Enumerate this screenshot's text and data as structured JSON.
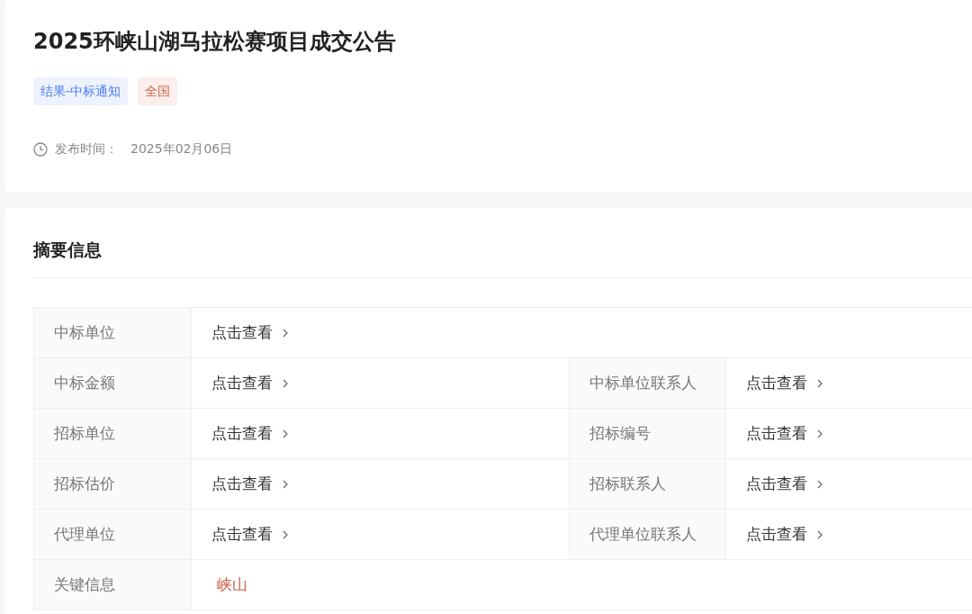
{
  "notice": {
    "title": "2025环峡山湖马拉松赛项目成交公告",
    "tags": [
      {
        "label": "结果-中标通知",
        "color": "#4e7bf0"
      },
      {
        "label": "全国",
        "color": "#d0624a"
      }
    ],
    "publish_label": "发布时间：",
    "publish_date": "2025年02月06日"
  },
  "summary": {
    "heading": "摘要信息",
    "rows": [
      {
        "cells": [
          {
            "label": "中标单位",
            "value": "点击查看",
            "kind": "link"
          }
        ]
      },
      {
        "cells": [
          {
            "label": "中标金额",
            "value": "点击查看",
            "kind": "link"
          },
          {
            "label": "中标单位联系人",
            "value": "点击查看",
            "kind": "link"
          }
        ]
      },
      {
        "cells": [
          {
            "label": "招标单位",
            "value": "点击查看",
            "kind": "link"
          },
          {
            "label": "招标编号",
            "value": "点击查看",
            "kind": "link"
          }
        ]
      },
      {
        "cells": [
          {
            "label": "招标估价",
            "value": "点击查看",
            "kind": "link"
          },
          {
            "label": "招标联系人",
            "value": "点击查看",
            "kind": "link"
          }
        ]
      },
      {
        "cells": [
          {
            "label": "代理单位",
            "value": "点击查看",
            "kind": "link"
          },
          {
            "label": "代理单位联系人",
            "value": "点击查看",
            "kind": "link"
          }
        ]
      },
      {
        "cells": [
          {
            "label": "关键信息",
            "value": "峡山",
            "kind": "keyword"
          }
        ]
      }
    ]
  }
}
